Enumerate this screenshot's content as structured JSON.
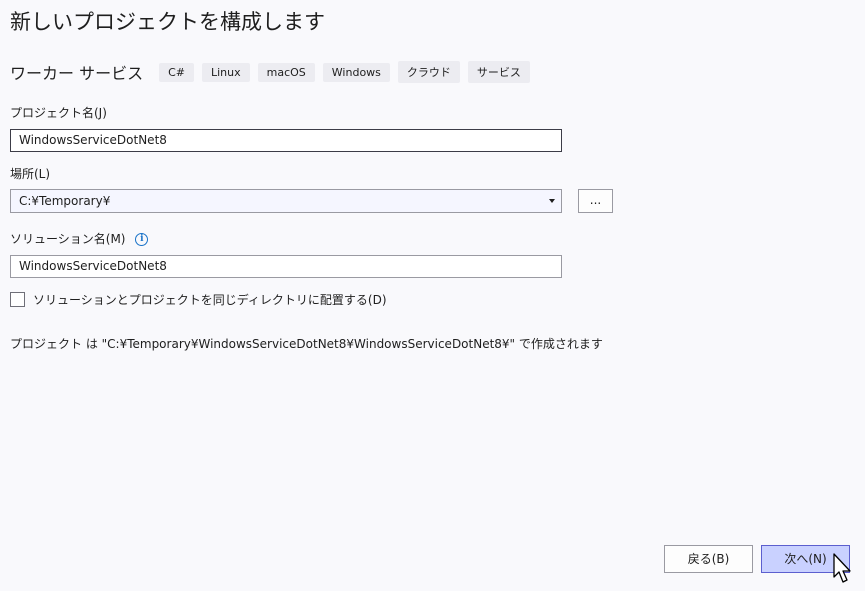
{
  "window": {
    "title": "新しいプロジェクトを構成します"
  },
  "template": {
    "name": "ワーカー サービス",
    "tags": [
      "C#",
      "Linux",
      "macOS",
      "Windows",
      "クラウド",
      "サービス"
    ]
  },
  "project_name": {
    "label": "プロジェクト名(J)",
    "value": "WindowsServiceDotNet8"
  },
  "location": {
    "label": "場所(L)",
    "value": "C:¥Temporary¥",
    "browse_label": "..."
  },
  "solution_name": {
    "label": "ソリューション名(M)",
    "value": "WindowsServiceDotNet8",
    "info_icon": "i"
  },
  "same_directory": {
    "label": "ソリューションとプロジェクトを同じディレクトリに配置する(D)",
    "checked": false
  },
  "summary": "プロジェクト は \"C:¥Temporary¥WindowsServiceDotNet8¥WindowsServiceDotNet8¥\" で作成されます",
  "buttons": {
    "back": "戻る(B)",
    "next": "次へ(N)"
  },
  "colors": {
    "accent_button": "#c9d1ff",
    "info_icon": "#1a73c8",
    "background": "#f9f9fc"
  }
}
